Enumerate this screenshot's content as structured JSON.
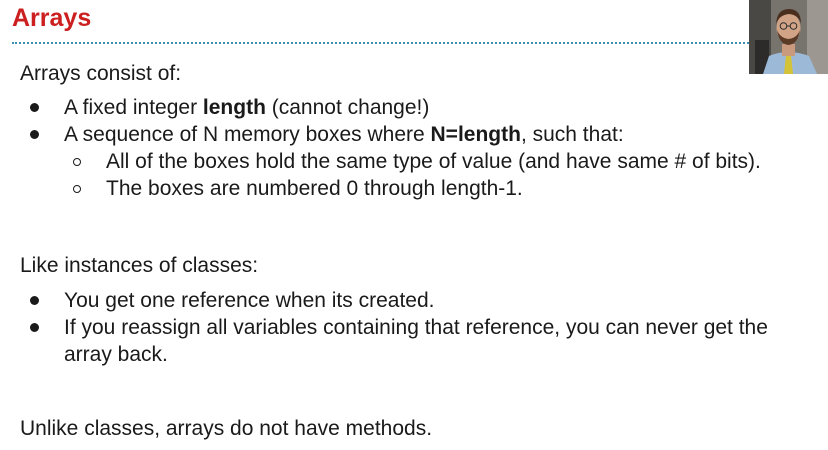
{
  "slide": {
    "title": "Arrays",
    "intro": "Arrays consist of:",
    "consist_items": [
      {
        "prefix": "A fixed integer ",
        "bold": "length",
        "suffix": " (cannot change!)"
      },
      {
        "prefix": "A sequence of N memory boxes where ",
        "bold": "N=length",
        "suffix": ", such that:"
      }
    ],
    "sub_items": [
      "All of the boxes hold the same type of value (and have same # of bits).",
      "The boxes are numbered 0 through length-1."
    ],
    "like_heading": "Like instances of classes:",
    "like_items": [
      "You get one reference when its created.",
      "If you reassign all variables containing that reference, you can never get the",
      "array back."
    ],
    "closing": "Unlike classes, arrays do not have methods."
  },
  "colors": {
    "title": "#cc1f1f",
    "rule": "#3a8fb0"
  }
}
